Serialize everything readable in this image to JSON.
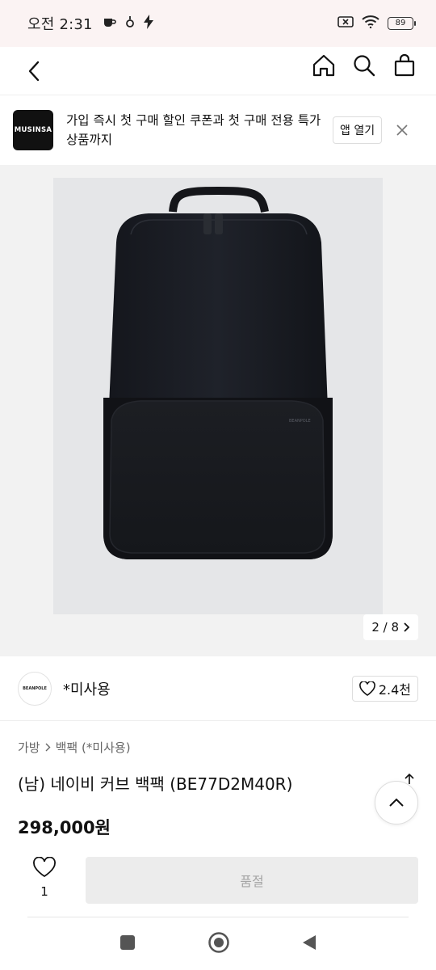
{
  "status": {
    "time": "오전 2:31",
    "battery": "89"
  },
  "header": {
    "icons": [
      "back-icon",
      "home-icon",
      "search-icon",
      "bag-icon"
    ]
  },
  "promo": {
    "logo_text": "MUSINSA",
    "message": "가입 즉시 첫 구매 할인 쿠폰과 첫 구매 전용 특가 상품까지",
    "open_app_label": "앱 열기"
  },
  "gallery": {
    "counter": "2 / 8",
    "product_logo_text": "BEANPOLE"
  },
  "brand": {
    "logo_text": "BEANPOLE",
    "name": "*미사용",
    "like_count": "2.4천"
  },
  "product": {
    "breadcrumb": [
      "가방",
      "백팩 (*미사용)"
    ],
    "title": "(남) 네이비 커브 백팩 (BE77D2M40R)",
    "price": "298,000원"
  },
  "actions": {
    "wish_count": "1",
    "soldout_label": "품절"
  },
  "colors": {
    "status_bg": "#fbf3f3",
    "gallery_bg": "#f2f2f2",
    "button_disabled_bg": "#ececec",
    "button_disabled_text": "#a5a5a5"
  }
}
